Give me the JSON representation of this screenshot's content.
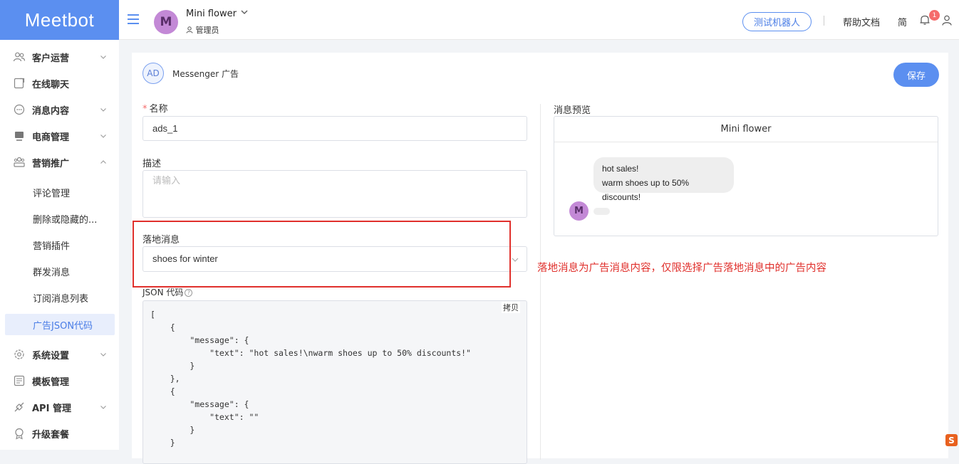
{
  "app": {
    "logo_text": "Meetbot"
  },
  "header": {
    "avatar_letter": "M",
    "account_name": "Mini flower",
    "role": "管理员",
    "test_robot_label": "测试机器人",
    "help_docs_label": "帮助文档",
    "lang_label": "简",
    "notification_count": "1"
  },
  "sidebar": {
    "items": [
      {
        "label": "客户运营",
        "icon": "users-icon",
        "expandable": true
      },
      {
        "label": "在线聊天",
        "icon": "chat-window-icon",
        "expandable": false
      },
      {
        "label": "消息内容",
        "icon": "message-bubble-icon",
        "expandable": true
      },
      {
        "label": "电商管理",
        "icon": "store-icon",
        "expandable": true
      },
      {
        "label": "营销推广",
        "icon": "megaphone-icon",
        "expandable": true,
        "expanded": true
      },
      {
        "label": "系统设置",
        "icon": "gear-icon",
        "expandable": true
      },
      {
        "label": "模板管理",
        "icon": "template-icon",
        "expandable": false
      },
      {
        "label": "API 管理",
        "icon": "api-icon",
        "expandable": true
      },
      {
        "label": "升级套餐",
        "icon": "upgrade-icon",
        "expandable": false
      }
    ],
    "sub_items": [
      {
        "label": "评论管理"
      },
      {
        "label": "删除或隐藏的..."
      },
      {
        "label": "营销插件"
      },
      {
        "label": "群发消息"
      },
      {
        "label": "订阅消息列表"
      },
      {
        "label": "广告JSON代码",
        "active": true
      }
    ]
  },
  "page": {
    "ad_badge": "AD",
    "title": "Messenger 广告",
    "save_label": "保存"
  },
  "form": {
    "name_label": "名称",
    "name_required_mark": "*",
    "name_value": "ads_1",
    "description_label": "描述",
    "description_placeholder": "请输入",
    "landing_label": "落地消息",
    "landing_value": "shoes for winter",
    "json_label": "JSON 代码",
    "copy_label": "拷贝",
    "json_code": "[\n    {\n        \"message\": {\n            \"text\": \"hot sales!\\nwarm shoes up to 50% discounts!\"\n        }\n    },\n    {\n        \"message\": {\n            \"text\": \"\"\n        }\n    }"
  },
  "preview": {
    "label": "消息预览",
    "page_name": "Mini flower",
    "bubble_line1": "hot sales!",
    "bubble_line2": "warm shoes up to 50% discounts!",
    "avatar_letter": "M"
  },
  "annotation": {
    "text": "落地消息为广告消息内容，仅限选择广告落地消息中的广告内容",
    "color": "#e0302c"
  },
  "colors": {
    "brand": "#5b8ff0",
    "avatar": "#c389d6",
    "badge": "#f56c6c"
  }
}
